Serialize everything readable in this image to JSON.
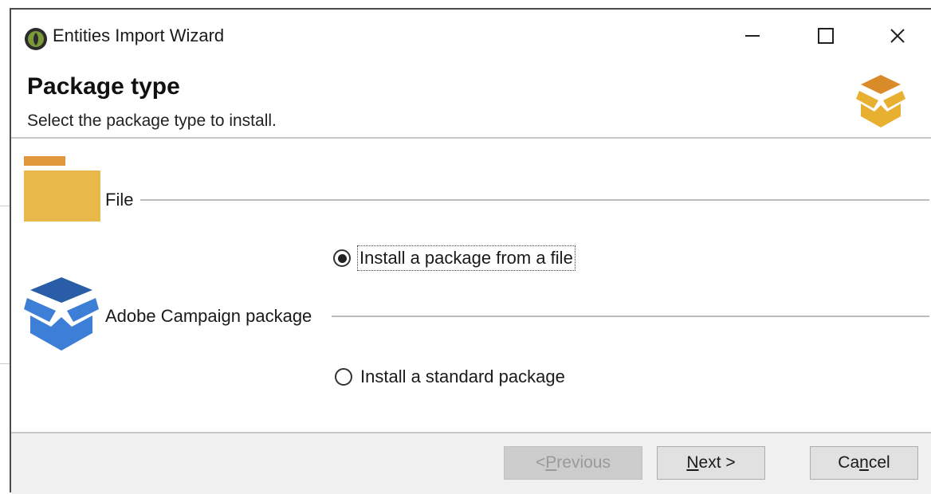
{
  "window": {
    "title": "Entities Import Wizard",
    "controls": {
      "minimize": "—",
      "maximize": "☐",
      "close": "✕"
    }
  },
  "header": {
    "title": "Package type",
    "subtitle": "Select the package type to install."
  },
  "groups": [
    {
      "label": "File",
      "icon": "folder-icon",
      "option": {
        "label": "Install a package from a file",
        "selected": true
      }
    },
    {
      "label": "Adobe Campaign package",
      "icon": "package-box-icon",
      "option": {
        "label": "Install a standard package",
        "selected": false
      }
    }
  ],
  "footer": {
    "previous": {
      "prefix": "< ",
      "mnemonic": "P",
      "rest": "revious",
      "enabled": false
    },
    "next": {
      "mnemonic": "N",
      "rest": "ext >",
      "enabled": true
    },
    "cancel": {
      "prefix": "Ca",
      "mnemonic": "n",
      "rest": "cel",
      "enabled": true
    }
  },
  "colors": {
    "folder": "#e8b84a",
    "folder_tab": "#e0963a",
    "box_blue_dark": "#2a5da8",
    "box_blue_light": "#3d7fd6",
    "box_gold": "#e8b030",
    "box_gold_dark": "#d98b2a"
  }
}
